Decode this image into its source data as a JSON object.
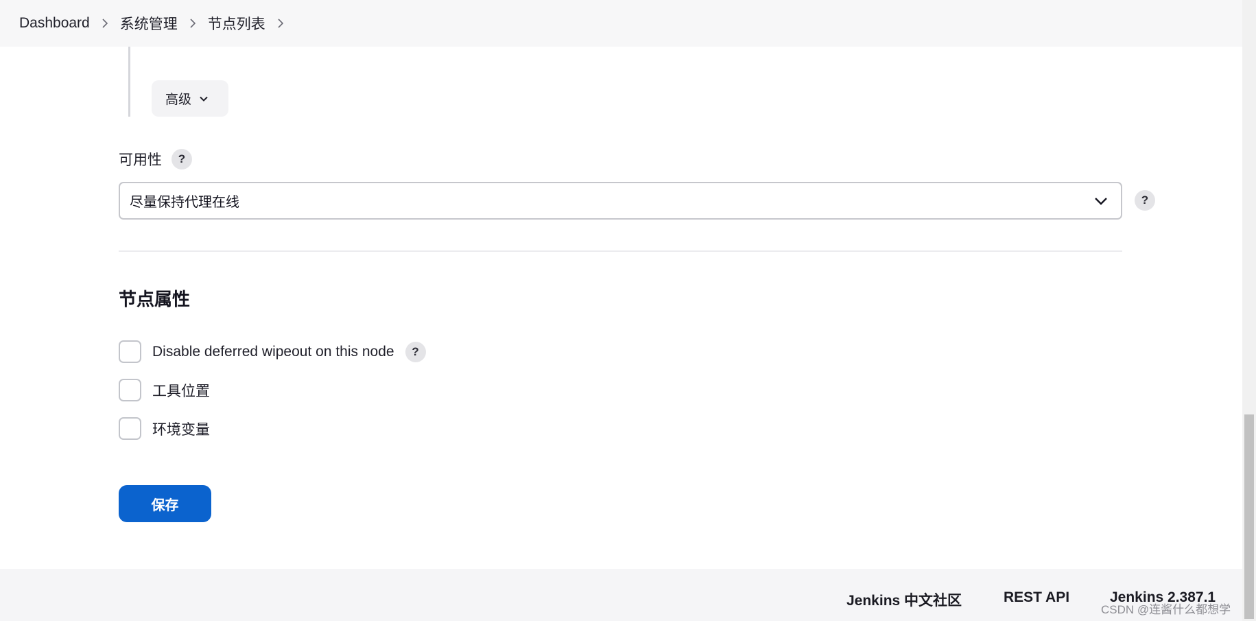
{
  "breadcrumb": {
    "items": [
      "Dashboard",
      "系统管理",
      "节点列表"
    ]
  },
  "advanced": {
    "label": "高级"
  },
  "availability": {
    "label": "可用性",
    "help": "?",
    "selected": "尽量保持代理在线",
    "select_help": "?"
  },
  "node_properties": {
    "title": "节点属性",
    "options": [
      {
        "label": "Disable deferred wipeout on this node",
        "help": "?",
        "checked": false
      },
      {
        "label": "工具位置",
        "checked": false
      },
      {
        "label": "环境变量",
        "checked": false
      }
    ]
  },
  "actions": {
    "save_label": "保存"
  },
  "footer": {
    "links": [
      "Jenkins 中文社区",
      "REST API",
      "Jenkins 2.387.1"
    ]
  },
  "watermark": "CSDN @连酱什么都想学",
  "colors": {
    "primary": "#0b63ce",
    "breadcrumb_bg": "#f7f7f8",
    "footer_bg": "#f5f5f7"
  },
  "icons": {
    "breadcrumb_separator": "chevron-right-icon",
    "advanced_toggle": "chevron-down-icon",
    "select_arrow": "chevron-down-icon",
    "help": "question-mark-icon"
  }
}
